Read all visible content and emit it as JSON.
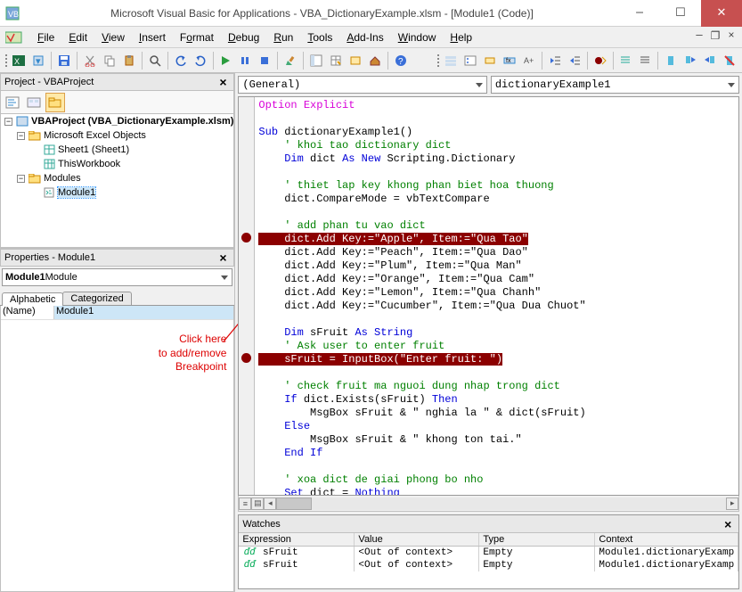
{
  "title": "Microsoft Visual Basic for Applications - VBA_DictionaryExample.xlsm - [Module1 (Code)]",
  "menus": [
    "File",
    "Edit",
    "View",
    "Insert",
    "Format",
    "Debug",
    "Run",
    "Tools",
    "Add-Ins",
    "Window",
    "Help"
  ],
  "project_pane_title": "Project - VBAProject",
  "tree": {
    "root": "VBAProject (VBA_DictionaryExample.xlsm)",
    "folder1": "Microsoft Excel Objects",
    "sheet1": "Sheet1 (Sheet1)",
    "thiswb": "ThisWorkbook",
    "folder2": "Modules",
    "module1": "Module1"
  },
  "props_title": "Properties - Module1",
  "props_combo_bold": "Module1",
  "props_combo_rest": " Module",
  "props_tab1": "Alphabetic",
  "props_tab2": "Categorized",
  "props_name_key": "(Name)",
  "props_name_val": "Module1",
  "annotation_l1": "Click here",
  "annotation_l2": "to add/remove",
  "annotation_l3": "Breakpoint",
  "combo_left": "(General)",
  "combo_right": "dictionaryExample1",
  "code": {
    "l1": "Option Explicit",
    "l3a": "Sub",
    "l3b": " dictionaryExample1()",
    "l4": "    ' khoi tao dictionary dict",
    "l5a": "    ",
    "l5b": "Dim",
    "l5c": " dict ",
    "l5d": "As New",
    "l5e": " Scripting.Dictionary",
    "l7": "    ' thiet lap key khong phan biet hoa thuong",
    "l8": "    dict.CompareMode = vbTextCompare",
    "l10": "    ' add phan tu vao dict",
    "l11": "    dict.Add Key:=\"Apple\", Item:=\"Qua Tao\"",
    "l12": "    dict.Add Key:=\"Peach\", Item:=\"Qua Dao\"",
    "l13": "    dict.Add Key:=\"Plum\", Item:=\"Qua Man\"",
    "l14": "    dict.Add Key:=\"Orange\", Item:=\"Qua Cam\"",
    "l15": "    dict.Add Key:=\"Lemon\", Item:=\"Qua Chanh\"",
    "l16": "    dict.Add Key:=\"Cucumber\", Item:=\"Qua Dua Chuot\"",
    "l18a": "    ",
    "l18b": "Dim",
    "l18c": " sFruit ",
    "l18d": "As String",
    "l19": "    ' Ask user to enter fruit",
    "l20": "    sFruit = InputBox(\"Enter fruit: \")",
    "l22": "    ' check fruit ma nguoi dung nhap trong dict",
    "l23a": "    ",
    "l23b": "If",
    "l23c": " dict.Exists(sFruit) ",
    "l23d": "Then",
    "l24": "        MsgBox sFruit & \" nghia la \" & dict(sFruit)",
    "l25": "    Else",
    "l26": "        MsgBox sFruit & \" khong ton tai.\"",
    "l27": "    End If",
    "l29": "    ' xoa dict de giai phong bo nho",
    "l30a": "    ",
    "l30b": "Set",
    "l30c": " dict = ",
    "l30d": "Nothing"
  },
  "watches_title": "Watches",
  "watch_headers": {
    "c1": "Expression",
    "c2": "Value",
    "c3": "Type",
    "c4": "Context"
  },
  "watch_rows": [
    {
      "icon": "ᵭᵭ",
      "expr": "sFruit",
      "val": "<Out of context>",
      "type": "Empty",
      "ctx": "Module1.dictionaryExamp"
    },
    {
      "icon": "ᵭᵭ",
      "expr": "sFruit",
      "val": "<Out of context>",
      "type": "Empty",
      "ctx": "Module1.dictionaryExamp"
    }
  ]
}
